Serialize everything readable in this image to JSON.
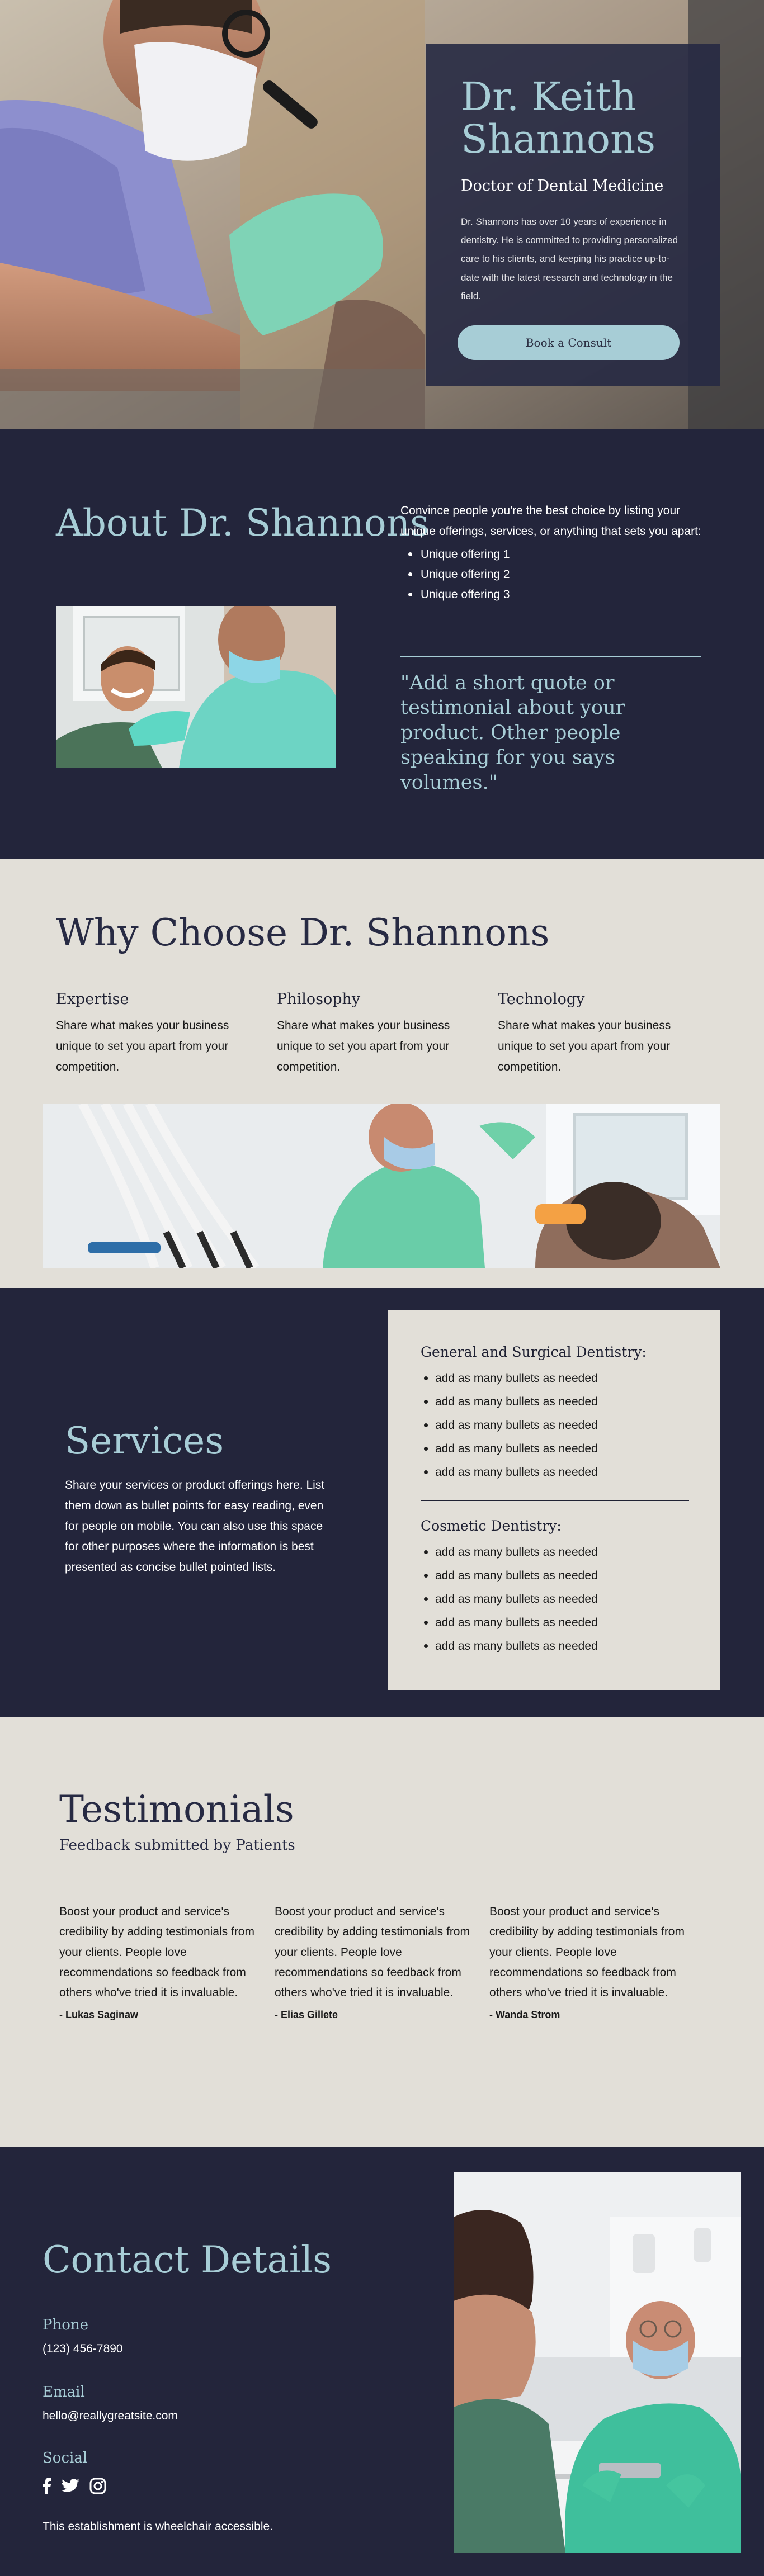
{
  "hero": {
    "name": "Dr. Keith Shannons",
    "subtitle": "Doctor of Dental Medicine",
    "text": "Dr. Shannons has over 10 years of experience in dentistry. He is committed to providing personalized care to his clients, and keeping his practice up-to-date with the latest research and technology in the field.",
    "cta": "Book a Consult"
  },
  "about": {
    "title": "About Dr. Shannons",
    "intro": "Convince people you're the best choice by listing your unique offerings, services, or anything that sets you apart:",
    "offerings": [
      "Unique offering 1",
      "Unique offering 2",
      "Unique offering 3"
    ],
    "quote": "\"Add a short quote or testimonial about your product. Other people speaking for you says volumes.\""
  },
  "why": {
    "title": "Why Choose Dr. Shannons",
    "columns": [
      {
        "heading": "Expertise",
        "text": "Share what makes your business unique to set you apart from your competition."
      },
      {
        "heading": "Philosophy",
        "text": "Share what makes your business unique to set you apart from your competition."
      },
      {
        "heading": "Technology",
        "text": "Share what makes your business unique to set you apart from your competition."
      }
    ]
  },
  "services": {
    "title": "Services",
    "text": "Share your services or product offerings here. List them down as bullet points for easy reading, even for people on mobile. You can also use this space for other purposes where the information is best presented as concise bullet pointed lists.",
    "groups": [
      {
        "heading": "General and Surgical Dentistry:",
        "items": [
          "add as many bullets as needed",
          "add as many bullets as needed",
          "add as many bullets as needed",
          "add as many bullets as needed",
          "add as many bullets as needed"
        ]
      },
      {
        "heading": "Cosmetic Dentistry:",
        "items": [
          "add as many bullets as needed",
          "add as many bullets as needed",
          "add as many bullets as needed",
          "add as many bullets as needed",
          "add as many bullets as needed"
        ]
      }
    ]
  },
  "testimonials": {
    "title": "Testimonials",
    "subtitle": "Feedback submitted by Patients",
    "items": [
      {
        "text": "Boost your product and service's credibility by adding testimonials from your clients. People love recommendations so feedback from others who've tried it is invaluable.",
        "author": "- Lukas Saginaw"
      },
      {
        "text": "Boost your product and service's credibility by adding testimonials from your clients. People love recommendations so feedback from others who've tried it is invaluable.",
        "author": "- Elias Gillete"
      },
      {
        "text": "Boost your product and service's credibility by adding testimonials from your clients. People love recommendations so feedback from others who've tried it is invaluable.",
        "author": "- Wanda Strom"
      }
    ]
  },
  "contact": {
    "title": "Contact Details",
    "phone_label": "Phone",
    "phone": "(123) 456-7890",
    "email_label": "Email",
    "email": "hello@reallygreatsite.com",
    "social_label": "Social",
    "social_icons": [
      "facebook-icon",
      "twitter-icon",
      "instagram-icon"
    ],
    "accessibility": "This establishment is wheelchair accessible."
  },
  "colors": {
    "navy": "#23253b",
    "accent": "#a7cdd6",
    "cream": "#e2dfd8"
  }
}
